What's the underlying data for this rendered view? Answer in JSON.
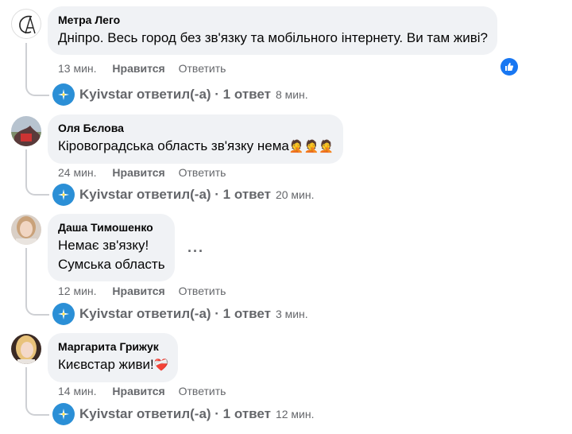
{
  "actions": {
    "like": "Нравится",
    "reply": "Ответить"
  },
  "comments": [
    {
      "author": "Метра Лего",
      "lines": [
        "Дніпро. Весь город без зв'язку та мобільного інтернету. Ви там живі?"
      ],
      "time": "13 мин.",
      "reply_label": "Kyivstar ответил(-а) · 1 ответ",
      "reply_time": "8 мин.",
      "has_like_badge": true
    },
    {
      "author": "Оля Бєлова",
      "lines": [
        "Кіровоградська область зв'язку нема"
      ],
      "emoji": "🤦🤦🤦",
      "time": "24 мин.",
      "reply_label": "Kyivstar ответил(-а) · 1 ответ",
      "reply_time": "20 мин."
    },
    {
      "author": "Даша Тимошенко",
      "lines": [
        "Немає зв'язку!",
        "Сумська область"
      ],
      "time": "12 мин.",
      "reply_label": "Kyivstar ответил(-а) · 1 ответ",
      "reply_time": "3 мин.",
      "more_label": "···"
    },
    {
      "author": "Маргарита Грижук",
      "lines": [
        "Києвстар живи!"
      ],
      "emoji": "❤️‍🩹",
      "time": "14 мин.",
      "reply_label": "Kyivstar ответил(-а) · 1 ответ",
      "reply_time": "12 мин."
    }
  ],
  "colors": {
    "kyivstar_blue": "#2b8fd6",
    "like_blue": "#1877f2",
    "bubble_bg": "#f0f2f5",
    "meta_gray": "#65676b"
  },
  "icons": {
    "like_badge": "thumbs-up-icon",
    "kyivstar_logo": "kyivstar-logo-icon"
  }
}
